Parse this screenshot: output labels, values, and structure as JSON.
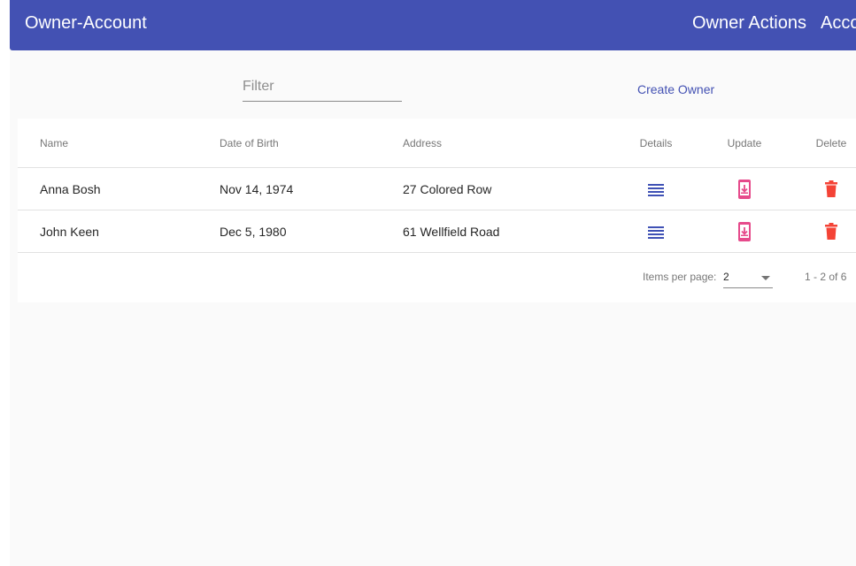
{
  "toolbar": {
    "title": "Owner-Account",
    "nav": [
      "Owner Actions",
      "Account Actions"
    ]
  },
  "filter": {
    "placeholder": "Filter",
    "value": ""
  },
  "create_owner": "Create Owner",
  "table": {
    "headers": {
      "name": "Name",
      "dob": "Date of Birth",
      "address": "Address",
      "details": "Details",
      "update": "Update",
      "delete": "Delete"
    },
    "rows": [
      {
        "name": "Anna Bosh",
        "dob": "Nov 14, 1974",
        "address": "27 Colored Row"
      },
      {
        "name": "John Keen",
        "dob": "Dec 5, 1980",
        "address": "61 Wellfield Road"
      }
    ]
  },
  "paginator": {
    "items_per_page_label": "Items per page:",
    "page_size": "2",
    "range": "1 - 2 of 6"
  },
  "icons": {
    "details": "list-icon",
    "update": "phone-download-icon",
    "delete": "trash-icon"
  },
  "colors": {
    "primary": "#4351b3",
    "accent": "#e64a8b",
    "warn": "#f44336",
    "background": "#fafafa"
  }
}
